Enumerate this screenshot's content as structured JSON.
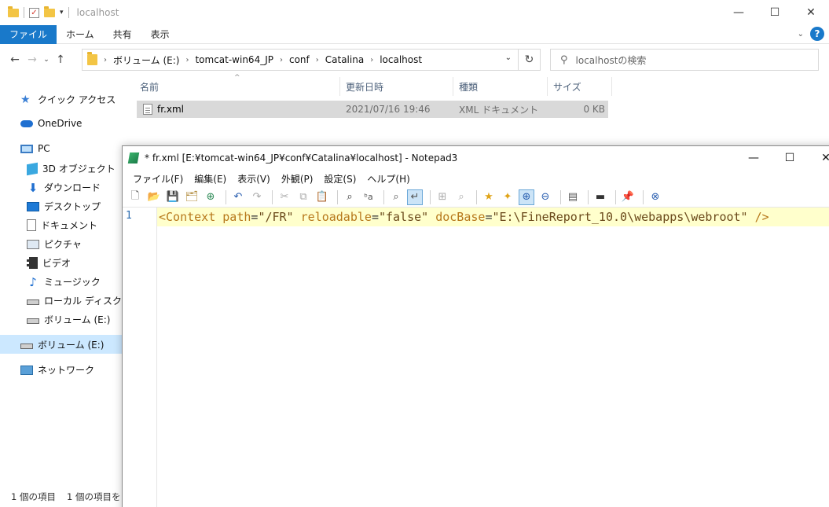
{
  "explorer": {
    "title": "localhost",
    "ribbon_tabs": [
      "ファイル",
      "ホーム",
      "共有",
      "表示"
    ],
    "breadcrumbs": [
      "ボリューム (E:)",
      "tomcat-win64_JP",
      "conf",
      "Catalina",
      "localhost"
    ],
    "search_placeholder": "localhostの検索",
    "nav_items": [
      {
        "label": "クイック アクセス",
        "icon": "quick-access-star-icon"
      },
      {
        "label": "OneDrive",
        "icon": "onedrive-cloud-icon"
      },
      {
        "label": "PC",
        "icon": "pc-icon"
      },
      {
        "label": "3D オブジェクト",
        "icon": "3d-objects-icon"
      },
      {
        "label": "ダウンロード",
        "icon": "downloads-icon"
      },
      {
        "label": "デスクトップ",
        "icon": "desktop-icon"
      },
      {
        "label": "ドキュメント",
        "icon": "documents-icon"
      },
      {
        "label": "ピクチャ",
        "icon": "pictures-icon"
      },
      {
        "label": "ビデオ",
        "icon": "videos-icon"
      },
      {
        "label": "ミュージック",
        "icon": "music-icon"
      },
      {
        "label": "ローカル ディスク (C:)",
        "icon": "local-disk-icon"
      },
      {
        "label": "ボリューム (E:)",
        "icon": "volume-drive-icon"
      },
      {
        "label": "ボリューム (E:)",
        "icon": "volume-drive-icon"
      },
      {
        "label": "ネットワーク",
        "icon": "network-icon"
      }
    ],
    "columns": [
      "名前",
      "更新日時",
      "種類",
      "サイズ"
    ],
    "files": [
      {
        "name": "fr.xml",
        "modified": "2021/07/16 19:46",
        "type": "XML ドキュメント",
        "size": "0 KB"
      }
    ],
    "status": {
      "count": "1 個の項目",
      "selected": "1 個の項目を"
    }
  },
  "notepad": {
    "title": "* fr.xml [E:¥tomcat-win64_JP¥conf¥Catalina¥localhost] - Notepad3",
    "menu": [
      "ファイル(F)",
      "編集(E)",
      "表示(V)",
      "外観(P)",
      "設定(S)",
      "ヘルプ(H)"
    ],
    "line_number": "1",
    "code": {
      "tag_open": "<Context",
      "attr1": "path",
      "val1": "\"/FR\"",
      "attr2": "reloadable",
      "val2": "\"false\"",
      "attr3": "docBase",
      "val3": "\"E:\\FineReport_10.0\\webapps\\webroot\"",
      "tag_close": "/>"
    }
  },
  "window_controls": {
    "minimize": "—",
    "maximize": "☐",
    "close": "✕"
  },
  "colors": {
    "accent": "#1979ca",
    "selection": "#d9d9d9",
    "current_line": "#ffffcc",
    "xml_tag": "#b7781b"
  }
}
